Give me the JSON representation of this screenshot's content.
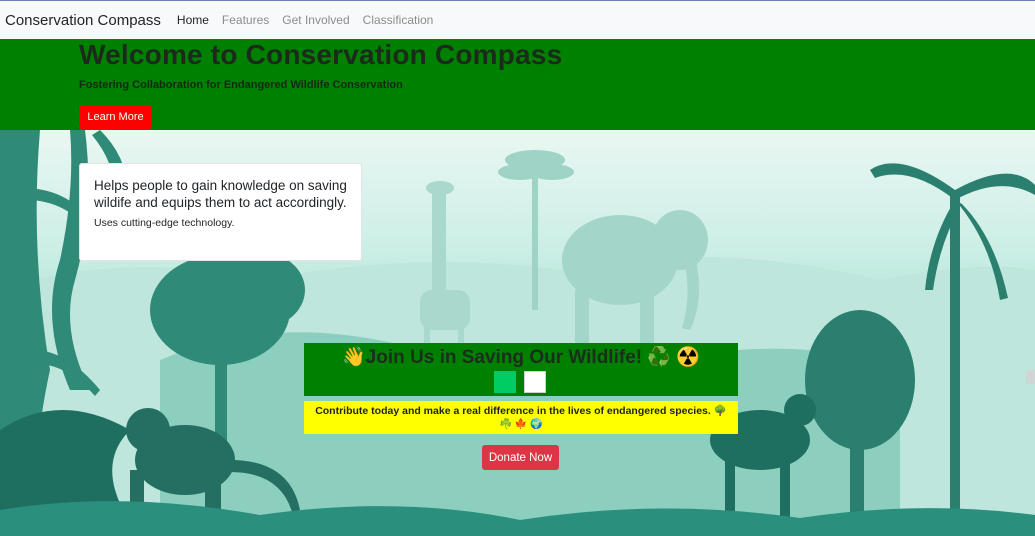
{
  "navbar": {
    "brand": "Conservation Compass",
    "links": [
      {
        "label": "Home",
        "active": true
      },
      {
        "label": "Features",
        "active": false
      },
      {
        "label": "Get Involved",
        "active": false
      },
      {
        "label": "Classification",
        "active": false
      }
    ]
  },
  "hero": {
    "title": "Welcome to Conservation Compass",
    "subtitle": "Fostering Collaboration for Endangered Wildlife Conservation",
    "button_label": "Learn More",
    "background_color": "#008000",
    "button_color": "#ff0000"
  },
  "info_card": {
    "title": "Helps people to gain knowledge on saving wildife and equips them to act accordingly.",
    "text": "Uses cutting-edge technology."
  },
  "join": {
    "title": "👋Join Us in Saving Our Wildlife! ♻️ ☢️",
    "contribution_text": "Contribute today and make a real difference in the lives of endangered species. 🌳",
    "contribution_icons": "☘️ 🍁 🌍",
    "donate_label": "Donate Now",
    "donate_color": "#dc3545"
  },
  "background": {
    "description_icon": "jungle-wildlife-silhouette-illustration"
  }
}
